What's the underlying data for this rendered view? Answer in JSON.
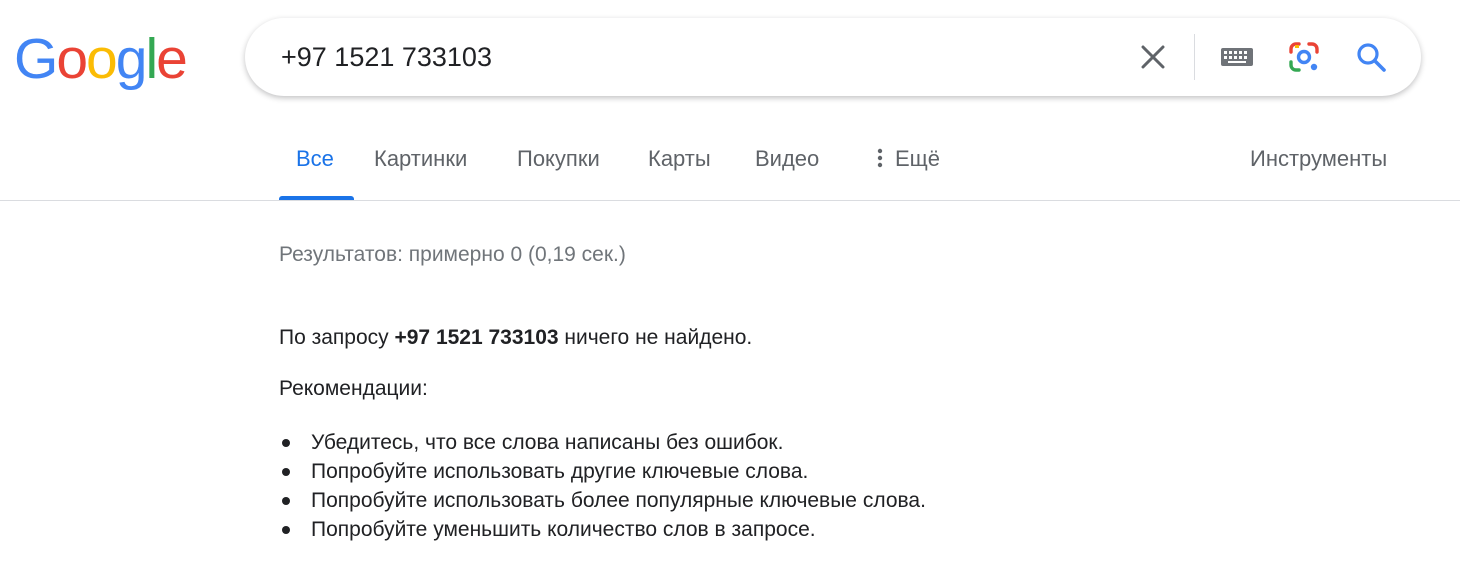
{
  "logo": {
    "letters": [
      "G",
      "o",
      "o",
      "g",
      "l",
      "e"
    ],
    "colors": [
      "#4285F4",
      "#EA4335",
      "#FBBC05",
      "#4285F4",
      "#34A853",
      "#EA4335"
    ]
  },
  "search": {
    "value": "+97 1521 733103",
    "icons": [
      "close-icon",
      "keyboard-icon",
      "google-lens-icon",
      "search-icon"
    ]
  },
  "tabs": {
    "items": [
      {
        "label": "Все",
        "active": true
      },
      {
        "label": "Картинки"
      },
      {
        "label": "Покупки"
      },
      {
        "label": "Карты"
      },
      {
        "label": "Видео"
      },
      {
        "label": "Ещё",
        "icon": "more-vert-icon"
      }
    ],
    "tools": "Инструменты"
  },
  "results": {
    "stats": "Результатов: примерно 0 (0,19 сек.)",
    "noresult_prefix": "По запросу ",
    "query": "+97 1521 733103",
    "noresult_suffix": " ничего не найдено.",
    "recommendations_title": "Рекомендации:",
    "recommendations": [
      "Убедитесь, что все слова написаны без ошибок.",
      "Попробуйте использовать другие ключевые слова.",
      "Попробуйте использовать более популярные ключевые слова.",
      "Попробуйте уменьшить количество слов в запросе."
    ]
  },
  "colors": {
    "accent": "#1a73e8",
    "text": "#202124",
    "muted": "#5f6368",
    "stats": "#70757a"
  }
}
